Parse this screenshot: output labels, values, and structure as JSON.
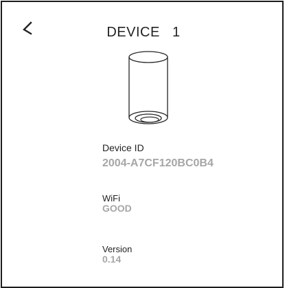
{
  "header": {
    "title": "DEVICE   1"
  },
  "icons": {
    "back": "back-arrow-icon",
    "device": "camera-device-icon"
  },
  "details": {
    "device_id_label": "Device ID",
    "device_id_value": "2004-A7CF120BC0B4",
    "wifi_label": "WiFi",
    "wifi_value": "GOOD",
    "version_label": "Version",
    "version_value": "0.14"
  },
  "colors": {
    "text": "#222222",
    "value_gray": "#a6a6a6",
    "border": "#1c1c1c"
  }
}
